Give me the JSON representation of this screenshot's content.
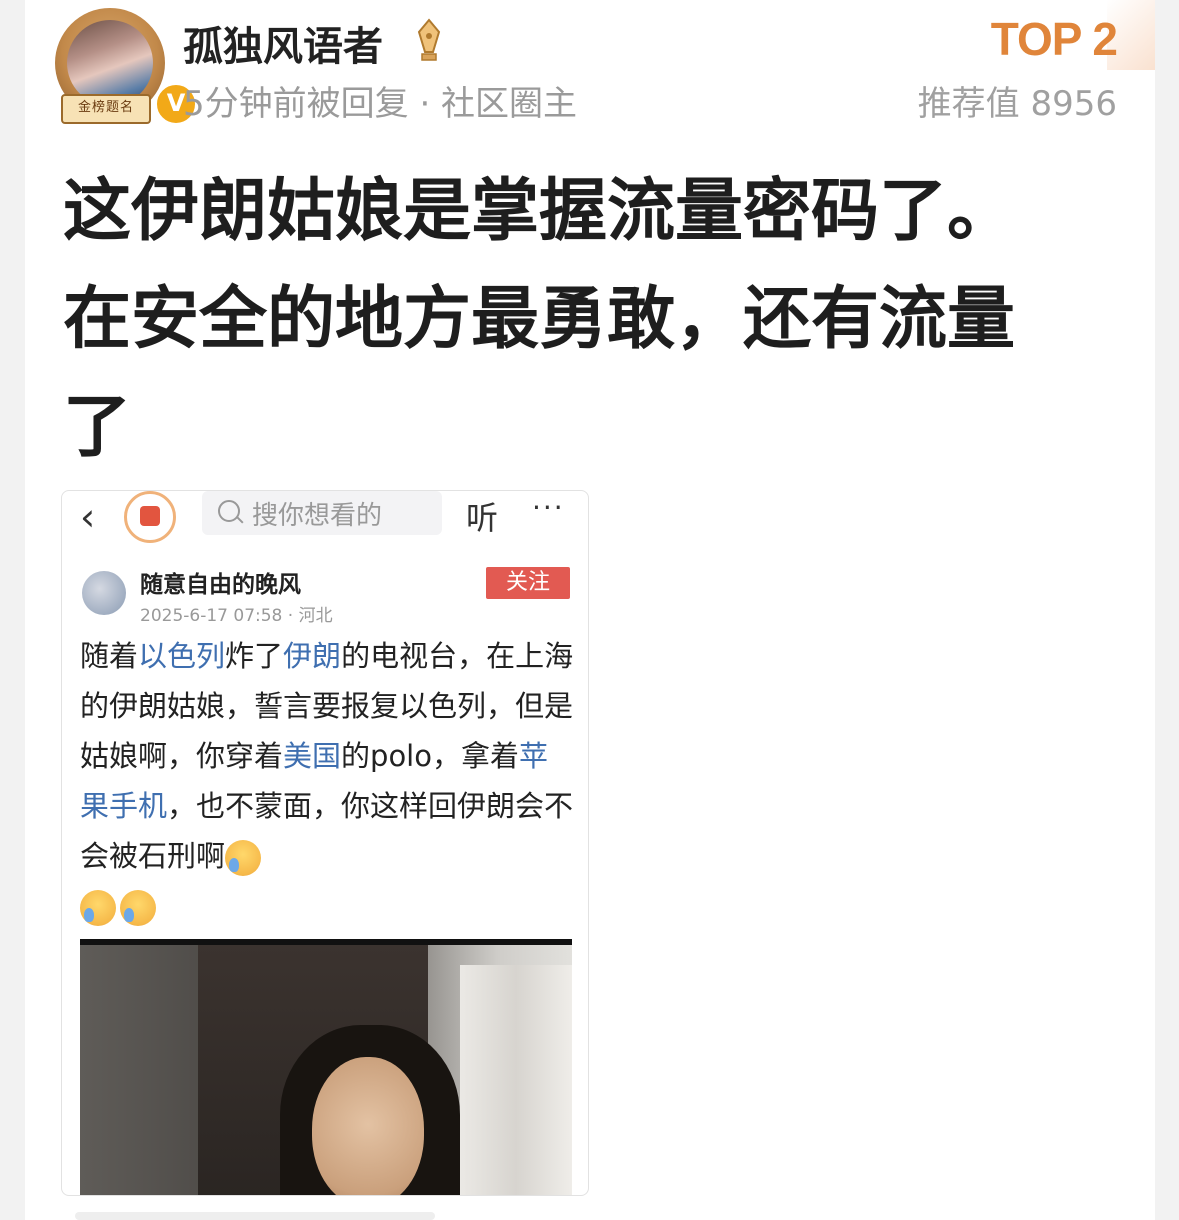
{
  "post": {
    "author": "孤独风语者",
    "meta": "5分钟前被回复 · 社区圈主",
    "badge_text": "金榜题名",
    "verified_mark": "V",
    "rank": "TOP 2",
    "recommend": "推荐值 8956",
    "text_line1": "这伊朗姑娘是掌握流量密码了。",
    "text_line2": "在安全的地方最勇敢，还有流量",
    "text_line3": "了",
    "accent_color": "#e0853a"
  },
  "embed": {
    "back_icon": "chevron-left-icon",
    "search_placeholder": "搜你想看的",
    "listen": "听",
    "more": "···",
    "author": "随意自由的晚风",
    "time": "2025-6-17 07:58 · 河北",
    "follow": "关注",
    "body": {
      "p1": "随着",
      "l1": "以色列",
      "p2": "炸了",
      "l2": "伊朗",
      "p3": "的电视台，在上海的伊朗姑娘，誓言要报复以色列，但是姑娘啊，你穿着",
      "l3": "美国",
      "p4": "的polo，拿着",
      "l4": "苹果手机",
      "p5": "，也不蒙面，你这样回伊朗会不会被石刑啊"
    },
    "link_color": "#3f6fb0",
    "follow_color": "#e25a52"
  }
}
